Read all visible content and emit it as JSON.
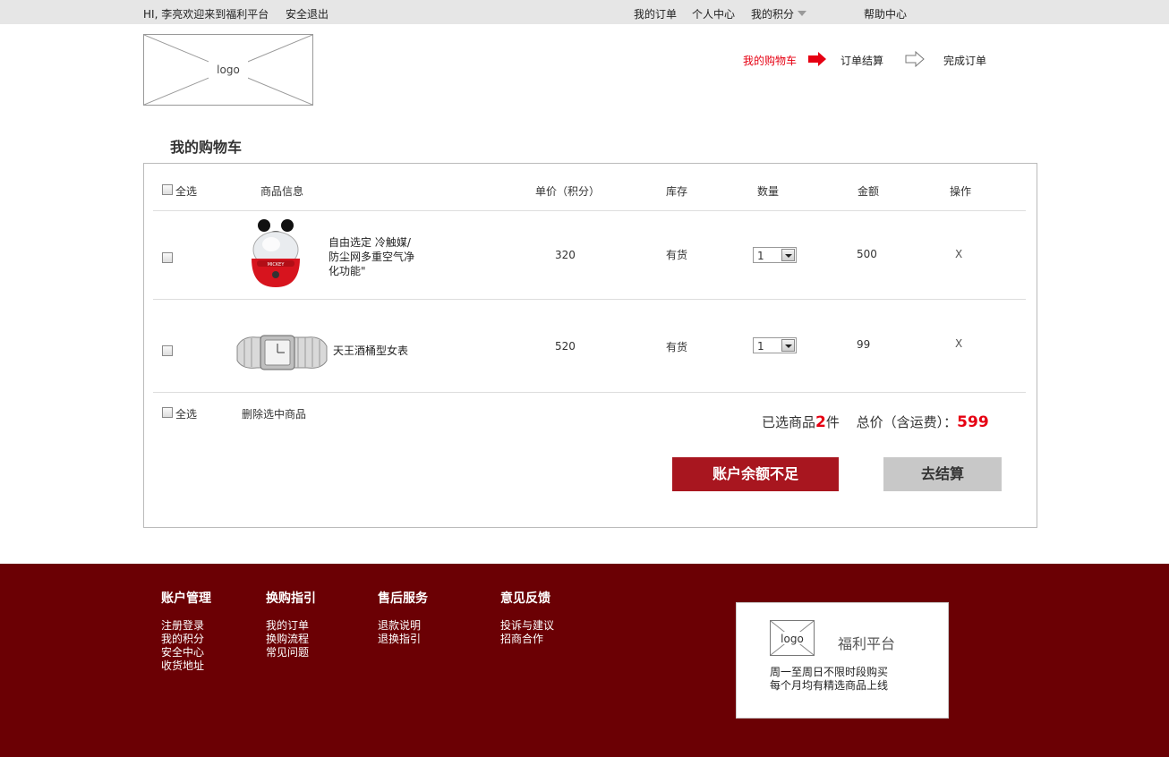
{
  "topbar": {
    "greeting": "HI, 李亮欢迎来到福利平台",
    "logout": "安全退出",
    "my_orders": "我的订单",
    "personal_center": "个人中心",
    "my_points": "我的积分",
    "help_center": "帮助中心"
  },
  "header": {
    "logo": "logo",
    "steps": [
      "我的购物车",
      "订单结算",
      "完成订单"
    ],
    "active_color": "#e60012"
  },
  "cart": {
    "title": "我的购物车",
    "columns": {
      "select_all": "全选",
      "product_info": "商品信息",
      "unit_price": "单价（积分）",
      "stock": "库存",
      "quantity": "数量",
      "amount": "金额",
      "action": "操作"
    },
    "items": [
      {
        "image": "mickey-egg-cooker",
        "name": "自由选定 冷触媒/防尘网多重空气净化功能\"",
        "name_lines": [
          "自由选定 冷触媒/",
          "防尘网多重空气净",
          "化功能\""
        ],
        "price": "320",
        "stock": "有货",
        "quantity": "1",
        "amount": "500",
        "remove": "X"
      },
      {
        "image": "wristwatch",
        "name": "天王酒桶型女表",
        "price": "520",
        "stock": "有货",
        "quantity": "1",
        "amount": "99",
        "remove": "X"
      }
    ],
    "footer": {
      "select_all": "全选",
      "delete_selected": "删除选中商品",
      "selected_prefix": "已选商品",
      "selected_count": "2",
      "selected_suffix": "件",
      "total_label": "总价（含运费）：",
      "total_value": "599",
      "insufficient_button": "账户余额不足",
      "checkout_button": "去结算"
    }
  },
  "footer": {
    "columns": [
      {
        "heading": "账户管理",
        "links": [
          "注册登录",
          "我的积分",
          "安全中心",
          "收货地址"
        ]
      },
      {
        "heading": "换购指引",
        "links": [
          "我的订单",
          "换购流程",
          "常见问题"
        ]
      },
      {
        "heading": "售后服务",
        "links": [
          "退款说明",
          "退换指引"
        ]
      },
      {
        "heading": "意见反馈",
        "links": [
          "投诉与建议",
          "招商合作"
        ]
      }
    ],
    "brand_logo": "logo",
    "brand_name": "福利平台",
    "brand_desc": [
      "周一至周日不限时段购买",
      "每个月均有精选商品上线"
    ],
    "background": "#6b0004"
  }
}
